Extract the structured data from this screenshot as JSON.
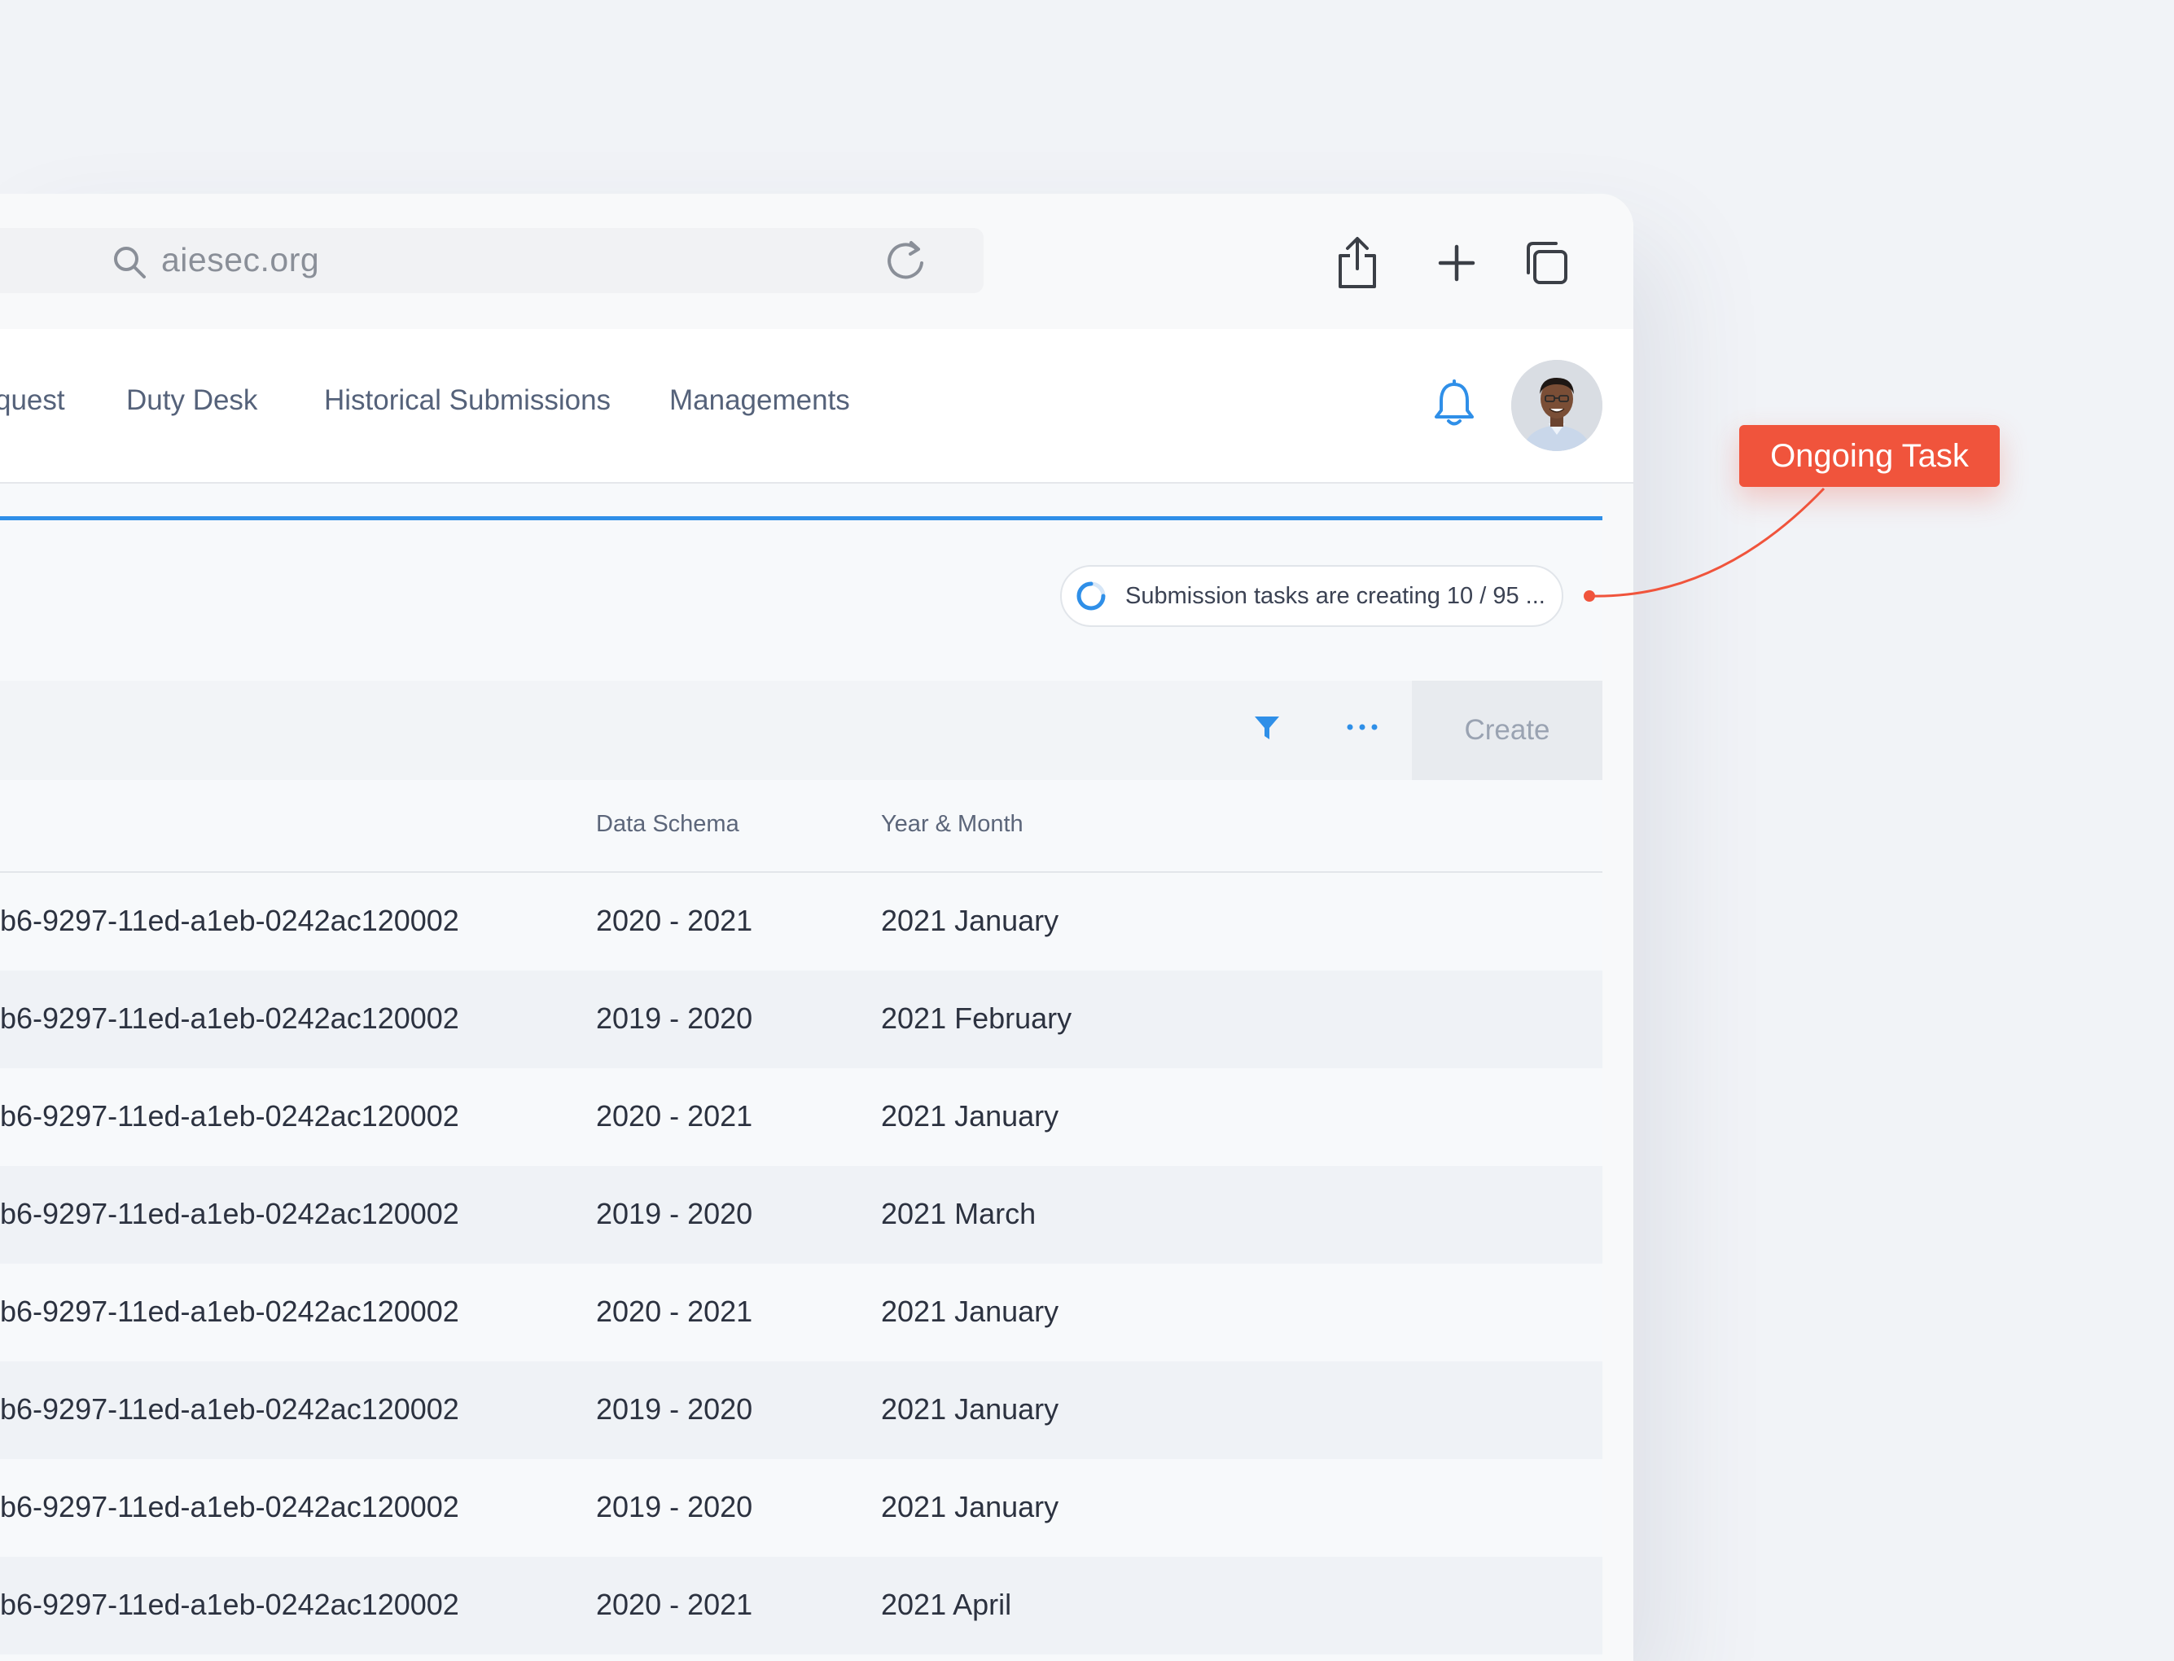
{
  "browser": {
    "address": "aiesec.org"
  },
  "nav": {
    "items": [
      {
        "label": "quest"
      },
      {
        "label": "Duty Desk"
      },
      {
        "label": "Historical Submissions"
      },
      {
        "label": "Managements"
      }
    ]
  },
  "task_status": {
    "text": "Submission tasks are creating 10 / 95 ..."
  },
  "actions": {
    "create_label": "Create"
  },
  "table": {
    "headers": {
      "schema": "Data Schema",
      "year_month": "Year & Month"
    },
    "rows": [
      {
        "id": "b6-9297-11ed-a1eb-0242ac120002",
        "schema": "2020 - 2021",
        "year_month": "2021 January"
      },
      {
        "id": "b6-9297-11ed-a1eb-0242ac120002",
        "schema": "2019 - 2020",
        "year_month": "2021 February"
      },
      {
        "id": "b6-9297-11ed-a1eb-0242ac120002",
        "schema": "2020 - 2021",
        "year_month": "2021 January"
      },
      {
        "id": "b6-9297-11ed-a1eb-0242ac120002",
        "schema": "2019 - 2020",
        "year_month": "2021 March"
      },
      {
        "id": "b6-9297-11ed-a1eb-0242ac120002",
        "schema": "2020 - 2021",
        "year_month": "2021 January"
      },
      {
        "id": "b6-9297-11ed-a1eb-0242ac120002",
        "schema": "2019 - 2020",
        "year_month": "2021 January"
      },
      {
        "id": "b6-9297-11ed-a1eb-0242ac120002",
        "schema": "2019 - 2020",
        "year_month": "2021 January"
      },
      {
        "id": "b6-9297-11ed-a1eb-0242ac120002",
        "schema": "2020 - 2021",
        "year_month": "2021 April"
      }
    ]
  },
  "annotation": {
    "label": "Ongoing Task"
  },
  "icons": [
    "search-icon",
    "reload-icon",
    "share-icon",
    "new-tab-icon",
    "tabs-icon",
    "bell-icon",
    "spinner-icon",
    "filter-icon",
    "more-icon"
  ],
  "colors": {
    "accent": "#2f8fe8",
    "callout": "#f0543c",
    "text": "#2c3240",
    "muted": "#55627a"
  }
}
